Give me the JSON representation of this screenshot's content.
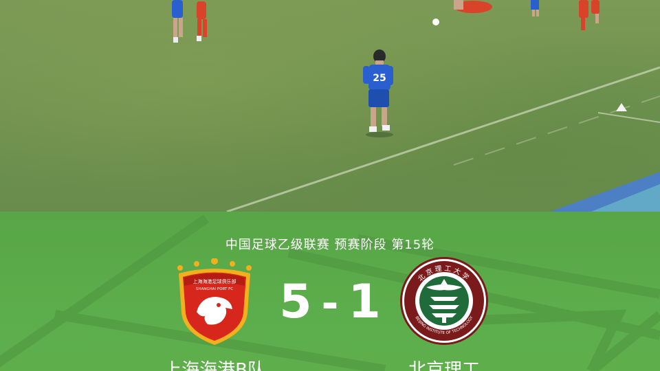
{
  "match": {
    "league_round": "中国足球乙级联赛 预赛阶段 第15轮",
    "home_team": "上海海港B队",
    "away_team": "北京理工",
    "home_score": "5",
    "separator": "-",
    "away_score": "1",
    "player_number": "25"
  },
  "home_logo": {
    "ring_text": "上海海港足球俱乐部",
    "sub_text": "SHANGHAI PORT FC"
  },
  "away_logo": {
    "ring_text": "北京理工大学",
    "sub_text": "BEIJING INSTITUTE OF TECHNOLOGY"
  },
  "colors": {
    "panel_green": "#5cad4b",
    "pitch_green": "#6f9250",
    "home_red": "#d7261c",
    "home_gold": "#f2b01e",
    "away_green": "#1f6b3a",
    "away_maroon": "#7a1a1a",
    "kit_blue": "#2a5fd0",
    "kit_red": "#d9432a"
  }
}
